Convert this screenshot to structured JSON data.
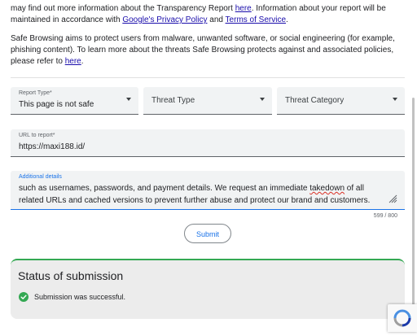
{
  "intro": {
    "p1_a": "may find out more information about the Transparency Report ",
    "p1_link1": "here",
    "p1_b": ". Information about your report will be",
    "p1_c": "maintained in accordance with ",
    "p1_link2": "Google's Privacy Policy",
    "p1_d": " and ",
    "p1_link3": "Terms of Service",
    "p1_e": ".",
    "p2_a": "Safe Browsing aims to protect users from malware, unwanted software, or social engineering (for example, phishing content). To learn more about the threats Safe Browsing protects against and associated policies, please refer to ",
    "p2_link": "here",
    "p2_b": "."
  },
  "form": {
    "report_type": {
      "label": "Report Type*",
      "value": "This page is not safe"
    },
    "threat_type": {
      "placeholder": "Threat Type"
    },
    "threat_category": {
      "placeholder": "Threat Category"
    },
    "url": {
      "label": "URL to report*",
      "value": "https://maxi188.id/"
    },
    "details": {
      "label": "Additional details",
      "text_a": "such as usernames, passwords, and payment details. We request an immediate ",
      "text_misspelled": "takedown",
      "text_b": " of all related URLs and cached versions to prevent further abuse and protect our brand and customers."
    },
    "counter": "599 / 800",
    "submit_label": "Submit"
  },
  "status": {
    "title": "Status of submission",
    "message": "Submission was successful.",
    "accent_color": "#34a853"
  },
  "icons": [
    "chevron-down-icon",
    "resize-handle-icon",
    "check-circle-icon",
    "recaptcha-icon"
  ]
}
